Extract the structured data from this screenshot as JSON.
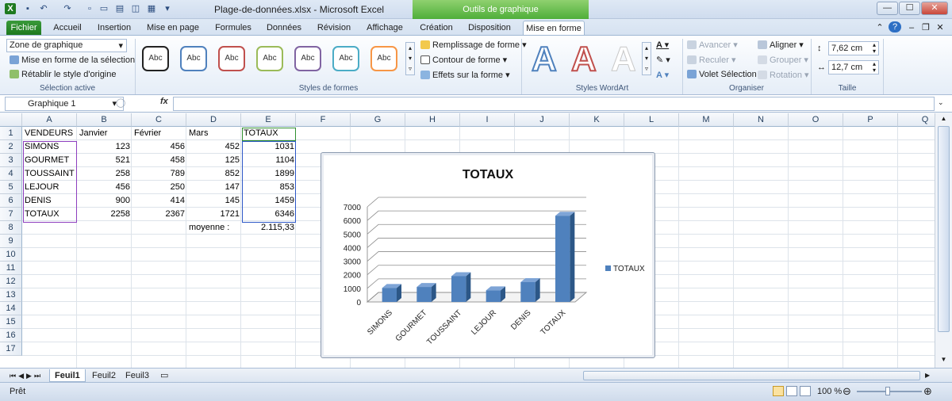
{
  "window": {
    "title": "Plage-de-données.xlsx  -  Microsoft Excel",
    "context_tab": "Outils de graphique",
    "minimize": "—",
    "maximize": "☐",
    "close": "✕"
  },
  "tabs": [
    "Fichier",
    "Accueil",
    "Insertion",
    "Mise en page",
    "Formules",
    "Données",
    "Révision",
    "Affichage",
    "Création",
    "Disposition",
    "Mise en forme"
  ],
  "ribbon": {
    "selection": {
      "dropdown": "Zone de graphique",
      "format_selection": "Mise en forme de la sélection",
      "reset_style": "Rétablir le style d'origine",
      "label": "Sélection active"
    },
    "shape_styles": {
      "sample": "Abc",
      "borders": [
        "#222222",
        "#4f81bd",
        "#c0504d",
        "#9bbb59",
        "#8064a2",
        "#4bacc6",
        "#f79646"
      ],
      "fill": "Remplissage de forme",
      "outline": "Contour de forme",
      "effects": "Effets sur la forme",
      "label": "Styles de formes"
    },
    "wordart": {
      "letter": "A",
      "label": "Styles WordArt"
    },
    "arrange": {
      "forward": "Avancer",
      "backward": "Reculer",
      "pane": "Volet Sélection",
      "align": "Aligner",
      "group": "Grouper",
      "rotate": "Rotation",
      "label": "Organiser"
    },
    "size": {
      "height": "7,62 cm",
      "width": "12,7 cm",
      "label": "Taille"
    }
  },
  "formula_bar": {
    "name_box": "Graphique 1",
    "fx": "fx",
    "value": ""
  },
  "sheet": {
    "columns": [
      "A",
      "B",
      "C",
      "D",
      "E",
      "F",
      "G",
      "H",
      "I",
      "J",
      "K",
      "L",
      "M",
      "N",
      "O",
      "P",
      "Q"
    ],
    "rows": [
      "1",
      "2",
      "3",
      "4",
      "5",
      "6",
      "7",
      "8",
      "9",
      "10",
      "11",
      "12",
      "13",
      "14",
      "15",
      "16",
      "17"
    ],
    "cells": {
      "r1": [
        "VENDEURS",
        "Janvier",
        "Février",
        "Mars",
        "TOTAUX"
      ],
      "r2": [
        "SIMONS",
        "123",
        "456",
        "452",
        "1031"
      ],
      "r3": [
        "GOURMET",
        "521",
        "458",
        "125",
        "1104"
      ],
      "r4": [
        "TOUSSAINT",
        "258",
        "789",
        "852",
        "1899"
      ],
      "r5": [
        "LEJOUR",
        "456",
        "250",
        "147",
        "853"
      ],
      "r6": [
        "DENIS",
        "900",
        "414",
        "145",
        "1459"
      ],
      "r7": [
        "TOTAUX",
        "2258",
        "2367",
        "1721",
        "6346"
      ],
      "r8": [
        "moyenne :",
        "2.115,33"
      ]
    }
  },
  "sheet_tabs": [
    "Feuil1",
    "Feuil2",
    "Feuil3"
  ],
  "status": {
    "ready": "Prêt",
    "zoom": "100 %"
  },
  "chart_data": {
    "type": "bar",
    "title": "TOTAUX",
    "categories": [
      "SIMONS",
      "GOURMET",
      "TOUSSAINT",
      "LEJOUR",
      "DENIS",
      "TOTAUX"
    ],
    "series": [
      {
        "name": "TOTAUX",
        "values": [
          1031,
          1104,
          1899,
          853,
          1459,
          6346
        ],
        "color": "#4f81bd"
      }
    ],
    "ylim": [
      0,
      7000
    ],
    "yticks": [
      "0",
      "1000",
      "2000",
      "3000",
      "4000",
      "5000",
      "6000",
      "7000"
    ],
    "grid": true,
    "legend": "right"
  }
}
